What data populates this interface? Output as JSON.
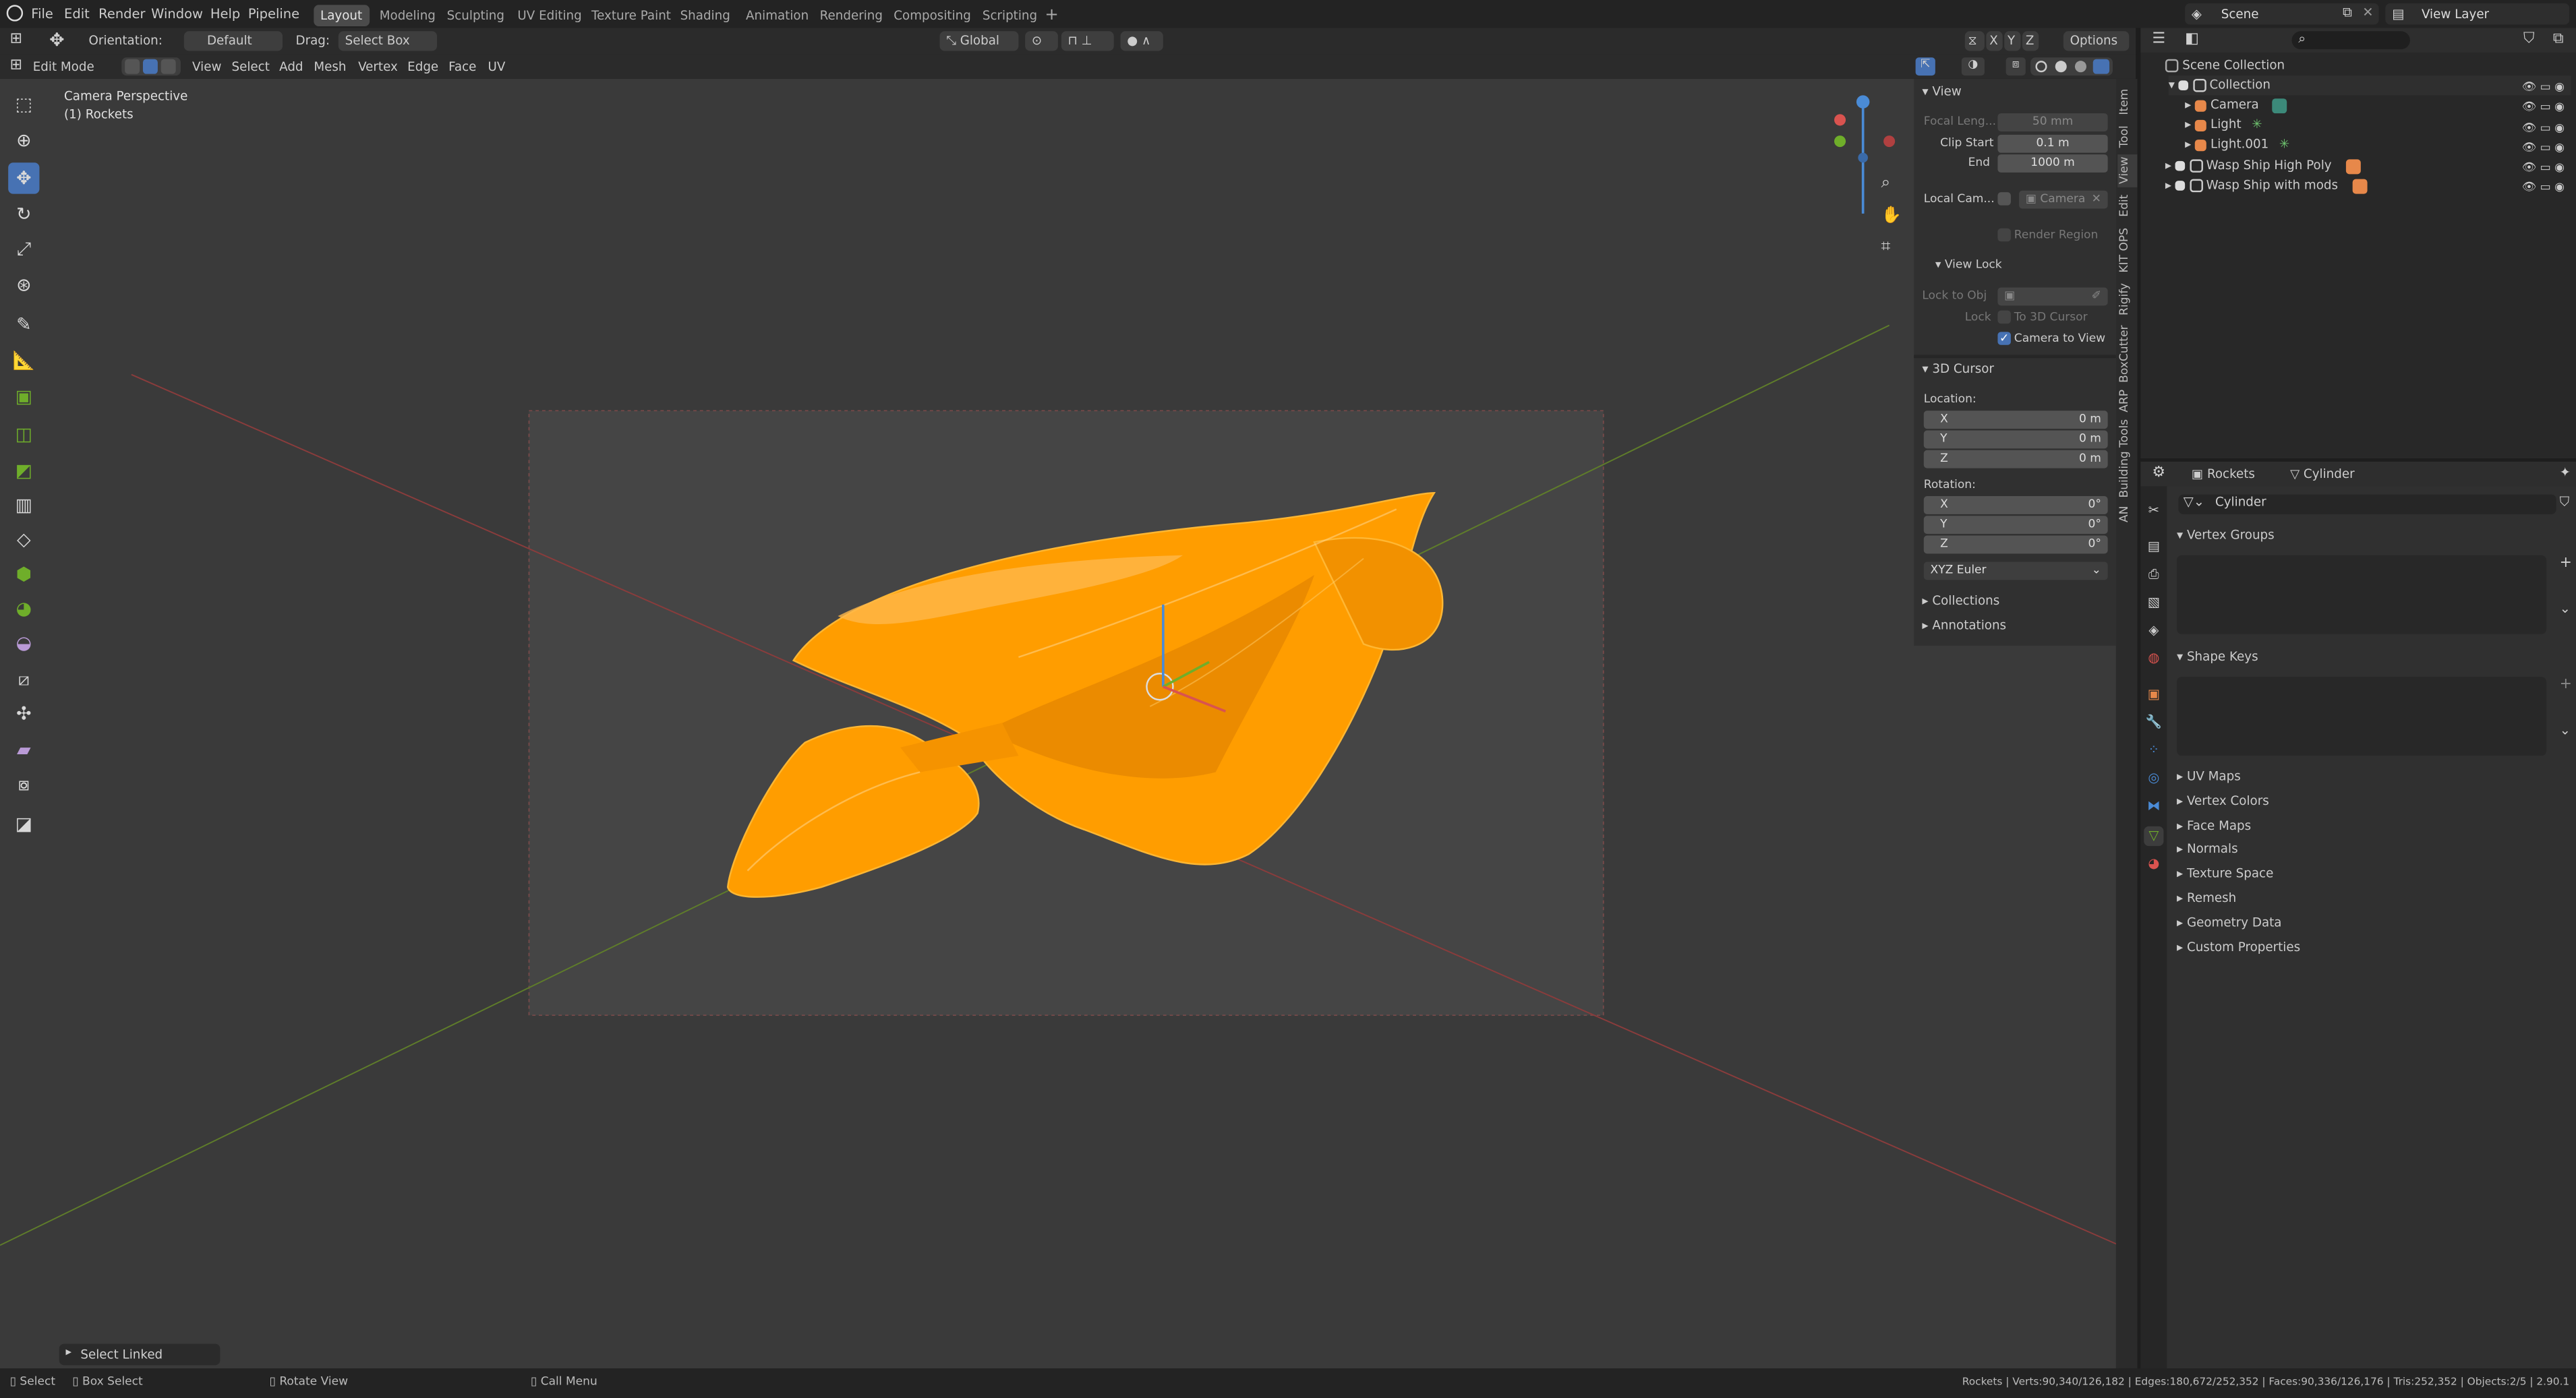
{
  "topbar": {
    "menus": [
      "File",
      "Edit",
      "Render",
      "Window",
      "Help",
      "Pipeline"
    ],
    "workspaces": [
      "Layout",
      "Modeling",
      "Sculpting",
      "UV Editing",
      "Texture Paint",
      "Shading",
      "Animation",
      "Rendering",
      "Compositing",
      "Scripting"
    ],
    "active_workspace": "Layout",
    "add_tab": "+",
    "scene": "Scene",
    "view_layer": "View Layer"
  },
  "tool_header": {
    "orientation_label": "Orientation:",
    "orientation_value": "Default",
    "drag_label": "Drag:",
    "drag_value": "Select Box",
    "transform_orientation": "Global",
    "axis_x": "X",
    "axis_y": "Y",
    "axis_z": "Z",
    "options": "Options"
  },
  "viewport_header": {
    "mode": "Edit Mode",
    "menus": [
      "View",
      "Select",
      "Add",
      "Mesh",
      "Vertex",
      "Edge",
      "Face",
      "UV"
    ]
  },
  "viewport": {
    "overlay_title": "Camera Perspective",
    "overlay_sub": "(1) Rockets",
    "last_op": "Select Linked",
    "accent_color": "#ffa200",
    "bg_color": "#3d3d3d"
  },
  "npanel": {
    "tabs": [
      "Item",
      "Tool",
      "View",
      "Edit",
      "KIT OPS",
      "Rigify",
      "BoxCutter",
      "ARP",
      "Building Tools",
      "AN"
    ],
    "view": {
      "header": "View",
      "focal_label": "Focal Leng...",
      "focal_value": "50 mm",
      "clip_start_label": "Clip Start",
      "clip_start_value": "0.1 m",
      "end_label": "End",
      "end_value": "1000 m",
      "local_cam_label": "Local Cam...",
      "local_cam_value": "Camera",
      "render_region": "Render Region",
      "view_lock_header": "View Lock",
      "lock_to_obj": "Lock to Obj",
      "lock_label": "Lock",
      "to_3d_cursor": "To 3D Cursor",
      "camera_to_view": "Camera to View"
    },
    "cursor": {
      "header": "3D Cursor",
      "location_label": "Location:",
      "loc": [
        {
          "axis": "X",
          "value": "0 m"
        },
        {
          "axis": "Y",
          "value": "0 m"
        },
        {
          "axis": "Z",
          "value": "0 m"
        }
      ],
      "rotation_label": "Rotation:",
      "rot": [
        {
          "axis": "X",
          "value": "0°"
        },
        {
          "axis": "Y",
          "value": "0°"
        },
        {
          "axis": "Z",
          "value": "0°"
        }
      ],
      "rotation_mode": "XYZ Euler"
    },
    "collections": "Collections",
    "annotations": "Annotations"
  },
  "outliner": {
    "root": "Scene Collection",
    "items": [
      {
        "name": "Collection"
      },
      {
        "name": "Camera"
      },
      {
        "name": "Light"
      },
      {
        "name": "Light.001"
      },
      {
        "name": "Wasp Ship High Poly"
      },
      {
        "name": "Wasp Ship with mods"
      }
    ]
  },
  "properties": {
    "breadcrumb_object": "Rockets",
    "breadcrumb_data": "Cylinder",
    "data_name": "Cylinder",
    "panels_open": [
      "Vertex Groups",
      "Shape Keys"
    ],
    "panels_closed": [
      "UV Maps",
      "Vertex Colors",
      "Face Maps",
      "Normals",
      "Texture Space",
      "Remesh",
      "Geometry Data",
      "Custom Properties"
    ]
  },
  "statusbar": {
    "select": "Select",
    "box_select": "Box Select",
    "rotate_view": "Rotate View",
    "call_menu": "Call Menu",
    "stats": "Rockets | Verts:90,340/126,182 | Edges:180,672/252,352 | Faces:90,336/126,176 | Tris:252,352 | Objects:2/5 | 2.90.1"
  }
}
